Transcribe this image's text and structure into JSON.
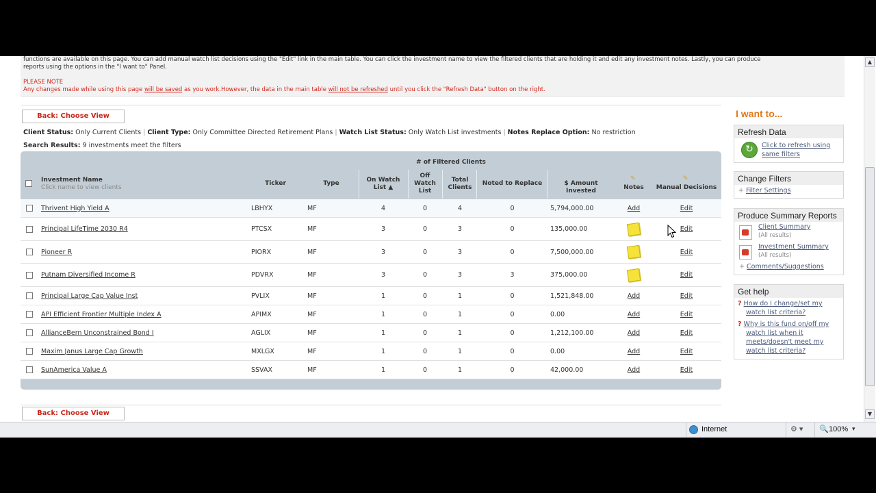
{
  "info": {
    "line1": "functions are available on this page. You can add manual watch list decisions using the \"Edit\" link in the main table. You can click the investment name to view the filtered clients that are holding it and edit any investment notes. Lastly, you can produce",
    "line2": "reports using the options in the \"I want to\" Panel.",
    "note_title": "PLEASE NOTE",
    "note_a": "Any changes made while using this page ",
    "note_b": "will be saved",
    "note_c": " as you work.However, the data in the main table ",
    "note_d": "will not be refreshed",
    "note_e": " until you click the \"Refresh Data\" button on the right."
  },
  "back_label": "Back: Choose View",
  "filters": {
    "client_status_label": "Client Status:",
    "client_status": "Only Current Clients",
    "client_type_label": "Client Type:",
    "client_type": "Only Committee Directed Retirement Plans",
    "watch_label": "Watch List Status:",
    "watch": "Only Watch List investments",
    "notes_label": "Notes Replace Option:",
    "notes": "No restriction",
    "sep": "|"
  },
  "search": {
    "label": "Search Results:",
    "text": "9 investments meet the filters"
  },
  "table": {
    "group_header": "# of Filtered Clients",
    "headers": {
      "name": "Investment Name",
      "name_sub": "Click name to view clients",
      "ticker": "Ticker",
      "type": "Type",
      "on_watch": "On Watch List ▲",
      "off_watch": "Off Watch List",
      "total": "Total Clients",
      "noted": "Noted to Replace",
      "amount": "$ Amount Invested",
      "notes": "Notes",
      "manual": "Manual Decisions"
    },
    "rows": [
      {
        "name": "Thrivent High Yield A",
        "ticker": "LBHYX",
        "type": "MF",
        "on": "4",
        "off": "0",
        "total": "4",
        "noted": "0",
        "amount": "5,794,000.00",
        "notes": "Add",
        "has_note": false,
        "edit": "Edit"
      },
      {
        "name": "Principal LifeTime 2030 R4",
        "ticker": "PTCSX",
        "type": "MF",
        "on": "3",
        "off": "0",
        "total": "3",
        "noted": "0",
        "amount": "135,000.00",
        "notes": "",
        "has_note": true,
        "edit": "Edit"
      },
      {
        "name": "Pioneer R",
        "ticker": "PIORX",
        "type": "MF",
        "on": "3",
        "off": "0",
        "total": "3",
        "noted": "0",
        "amount": "7,500,000.00",
        "notes": "",
        "has_note": true,
        "edit": "Edit"
      },
      {
        "name": "Putnam Diversified Income R",
        "ticker": "PDVRX",
        "type": "MF",
        "on": "3",
        "off": "0",
        "total": "3",
        "noted": "3",
        "amount": "375,000.00",
        "notes": "",
        "has_note": true,
        "edit": "Edit"
      },
      {
        "name": "Principal Large Cap Value Inst",
        "ticker": "PVLIX",
        "type": "MF",
        "on": "1",
        "off": "0",
        "total": "1",
        "noted": "0",
        "amount": "1,521,848.00",
        "notes": "Add",
        "has_note": false,
        "edit": "Edit"
      },
      {
        "name": "API Efficient Frontier Multiple Index A",
        "ticker": "APIMX",
        "type": "MF",
        "on": "1",
        "off": "0",
        "total": "1",
        "noted": "0",
        "amount": "0.00",
        "notes": "Add",
        "has_note": false,
        "edit": "Edit"
      },
      {
        "name": "AllianceBern Unconstrained Bond I",
        "ticker": "AGLIX",
        "type": "MF",
        "on": "1",
        "off": "0",
        "total": "1",
        "noted": "0",
        "amount": "1,212,100.00",
        "notes": "Add",
        "has_note": false,
        "edit": "Edit"
      },
      {
        "name": "Maxim Janus Large Cap Growth",
        "ticker": "MXLGX",
        "type": "MF",
        "on": "1",
        "off": "0",
        "total": "1",
        "noted": "0",
        "amount": "0.00",
        "notes": "Add",
        "has_note": false,
        "edit": "Edit"
      },
      {
        "name": "SunAmerica Value A",
        "ticker": "SSVAX",
        "type": "MF",
        "on": "1",
        "off": "0",
        "total": "1",
        "noted": "0",
        "amount": "42,000.00",
        "notes": "Add",
        "has_note": false,
        "edit": "Edit"
      }
    ]
  },
  "sidebar": {
    "title": "I want to...",
    "refresh": {
      "header": "Refresh Data",
      "link1": "Click to refresh using",
      "link2": "same filters"
    },
    "change": {
      "header": "Change Filters",
      "link": "Filter Settings"
    },
    "reports": {
      "header": "Produce Summary Reports",
      "client": "Client Summary",
      "client_sub": "(All results)",
      "investment": "Investment Summary",
      "investment_sub": "(All results)",
      "comments": "Comments/Suggestions"
    },
    "help": {
      "header": "Get help",
      "q1a": "How do I change/set my",
      "q1b": "watch list criteria?",
      "q2a": "Why is this fund on/off my",
      "q2b": "watch list when it",
      "q2c": "meets/doesn't meet my",
      "q2d": "watch list criteria?"
    }
  },
  "browser_status": {
    "zone": "Internet",
    "zoom": "100%"
  },
  "colors": {
    "accent": "#e0791c",
    "red": "#c8281b",
    "grid": "#c3cdd5"
  }
}
